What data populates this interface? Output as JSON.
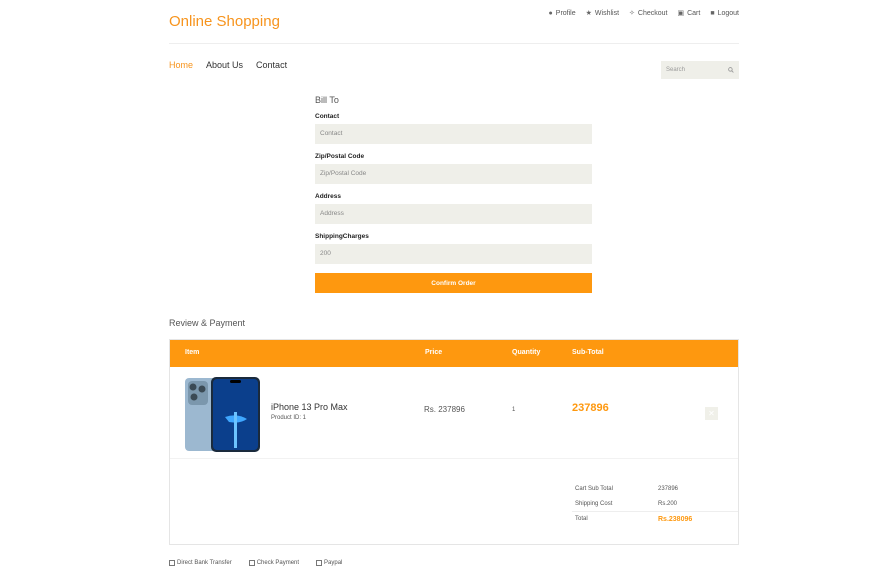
{
  "header": {
    "brand": "Online Shopping",
    "links": [
      {
        "label": "Profile",
        "icon": "user-icon"
      },
      {
        "label": "Wishlist",
        "icon": "star-icon"
      },
      {
        "label": "Checkout",
        "icon": "crosshair-icon"
      },
      {
        "label": "Cart",
        "icon": "cart-icon"
      },
      {
        "label": "Logout",
        "icon": "lock-icon"
      }
    ]
  },
  "nav": {
    "items": [
      "Home",
      "About Us",
      "Contact"
    ],
    "active": "Home"
  },
  "search": {
    "placeholder": "Search"
  },
  "bill_to": {
    "title": "Bill To",
    "fields": [
      {
        "label": "Contact",
        "placeholder": "Contact",
        "value": ""
      },
      {
        "label": "Zip/Postal Code",
        "placeholder": "Zip/Postal Code",
        "value": ""
      },
      {
        "label": "Address",
        "placeholder": "Address",
        "value": ""
      },
      {
        "label": "ShippingCharges",
        "placeholder": "",
        "value": "200"
      }
    ],
    "confirm_label": "Confirm Order"
  },
  "review": {
    "title": "Review & Payment",
    "columns": [
      "Item",
      "Price",
      "Quantity",
      "Sub-Total"
    ],
    "items": [
      {
        "name": "iPhone 13 Pro Max",
        "product_id": "Product ID: 1",
        "price": "Rs. 237896",
        "quantity": "1",
        "subtotal": "237896"
      }
    ],
    "totals": [
      {
        "label": "Cart Sub Total",
        "value": "237896"
      },
      {
        "label": "Shipping Cost",
        "value": "Rs.200"
      },
      {
        "label": "Total",
        "value": "Rs.238096"
      }
    ]
  },
  "payment": {
    "options": [
      "Direct Bank Transfer",
      "Check Payment",
      "Paypal"
    ]
  },
  "colors": {
    "accent": "#fe980f",
    "brand": "#f7941d",
    "input_bg": "#efefe9"
  }
}
